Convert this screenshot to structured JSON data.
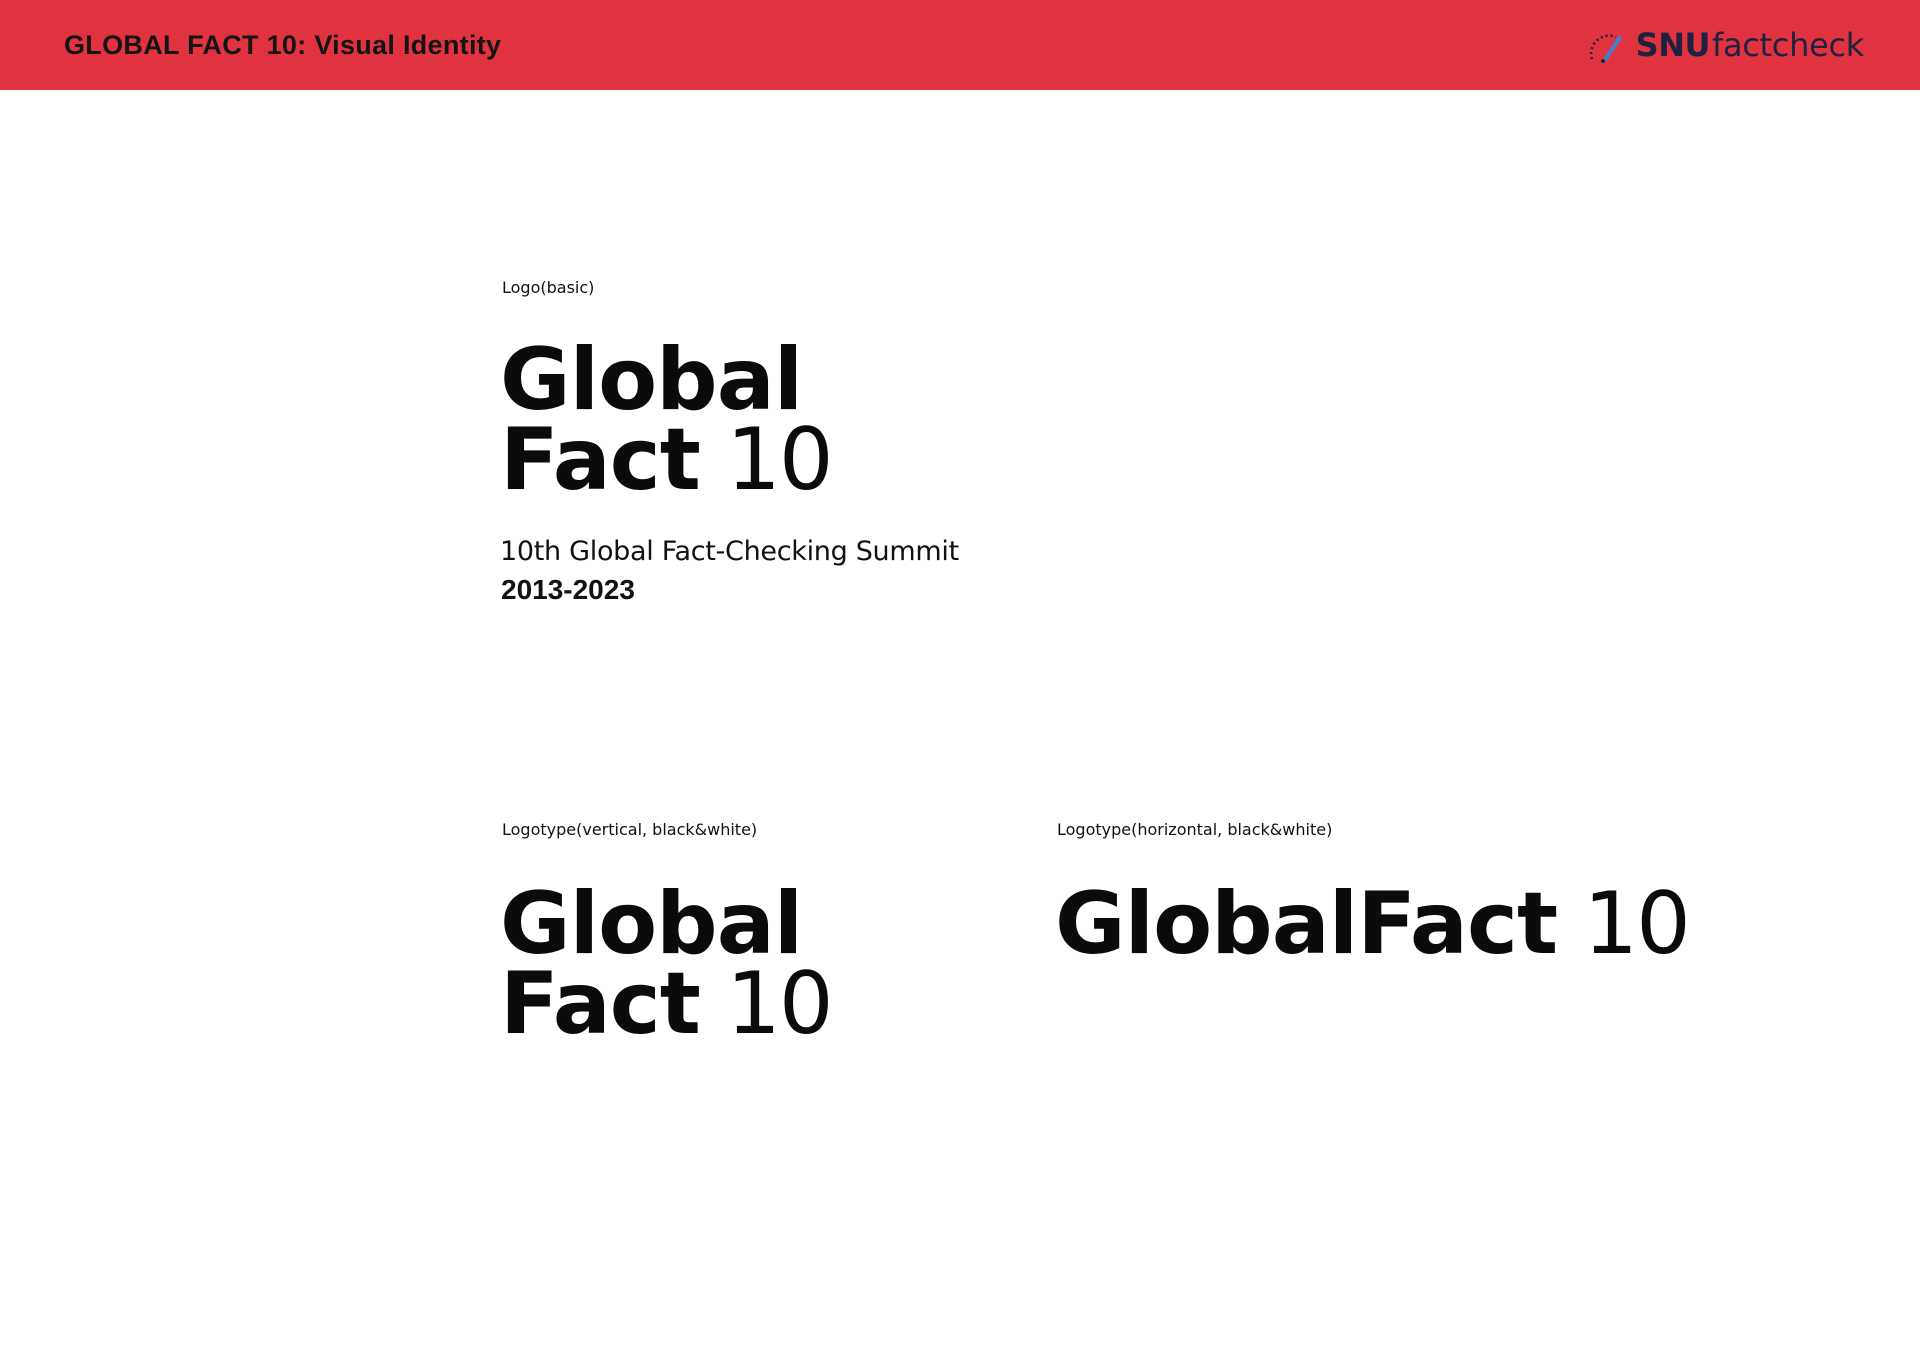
{
  "header": {
    "title": "GLOBAL FACT 10: Visual Identity",
    "brand_bold": "SNU",
    "brand_light": "factcheck",
    "brand_icon": "gauge-icon",
    "background_color": "#e1333f"
  },
  "basic_logo": {
    "label": "Logo(basic)",
    "line1": "Global",
    "line2_bold": "Fact",
    "line2_num": "10",
    "tagline": "10th Global Fact-Checking Summit",
    "years": "2013-2023"
  },
  "vertical_logotype": {
    "label": "Logotype(vertical, black&white)",
    "line1": "Global",
    "line2_bold": "Fact",
    "line2_num": "10"
  },
  "horizontal_logotype": {
    "label": "Logotype(horizontal, black&white)",
    "text_bold": "GlobalFact",
    "text_num": "10"
  }
}
